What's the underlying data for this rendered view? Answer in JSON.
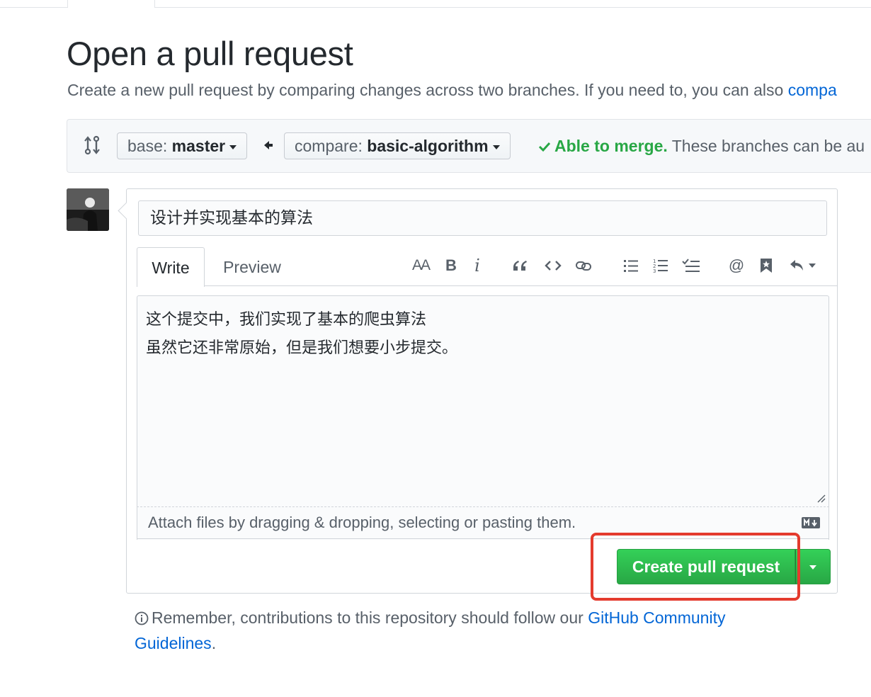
{
  "page": {
    "title": "Open a pull request",
    "subtitle_text": "Create a new pull request by comparing changes across two branches. If you need to, you can also ",
    "subtitle_link": "compa"
  },
  "range": {
    "base_prefix": "base: ",
    "base_branch": "master",
    "compare_prefix": "compare: ",
    "compare_branch": "basic-algorithm",
    "merge_ok": "Able to merge.",
    "merge_note": " These branches can be au"
  },
  "form": {
    "title_value": "设计并实现基本的算法",
    "tabs": {
      "write": "Write",
      "preview": "Preview"
    },
    "toolbar": {
      "header": "AA",
      "bold": "B",
      "italic": "i",
      "mention": "@"
    },
    "body_lines": [
      "这个提交中，我们实现了基本的爬虫算法",
      "虽然它还非常原始，但是我们想要小步提交。"
    ],
    "attach_text": "Attach files by dragging & dropping, selecting or pasting them.",
    "submit_label": "Create pull request"
  },
  "footer": {
    "note_text": "Remember, contributions to this repository should follow our ",
    "link_text": "GitHub Community Guidelines",
    "end": "."
  },
  "colors": {
    "accent_green": "#28a745",
    "link_blue": "#0366d6",
    "highlight_red": "#e43b2e"
  },
  "icons": [
    "git-compare-icon",
    "arrow-left-icon",
    "check-icon",
    "quote-icon",
    "code-icon",
    "link-icon",
    "unordered-list-icon",
    "ordered-list-icon",
    "task-list-icon",
    "bookmark-icon",
    "reply-icon",
    "markdown-icon",
    "info-icon"
  ]
}
